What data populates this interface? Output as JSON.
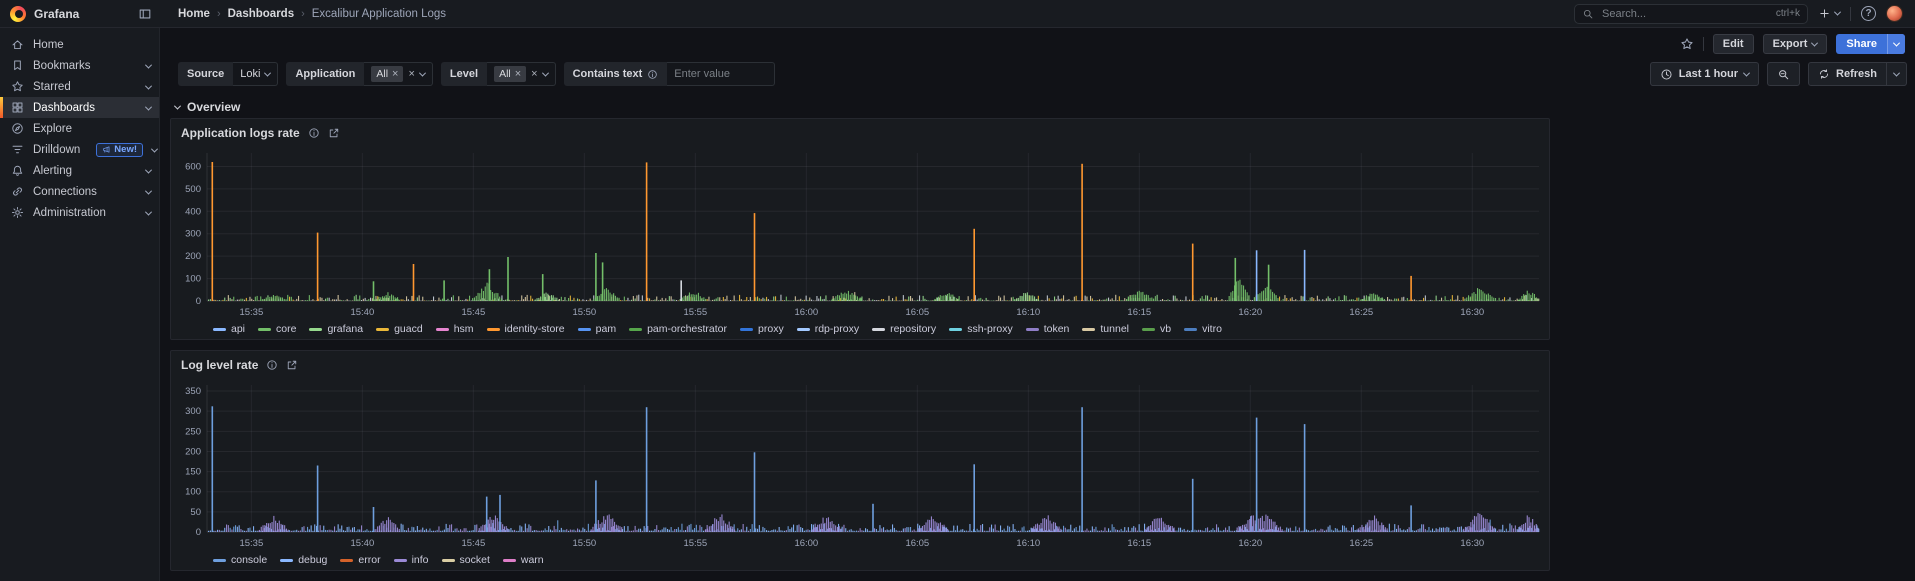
{
  "topbar": {
    "brand": "Grafana",
    "breadcrumb": [
      "Home",
      "Dashboards",
      "Excalibur Application Logs"
    ],
    "search_placeholder": "Search...",
    "search_shortcut": "ctrl+k"
  },
  "toolbar": {
    "edit_label": "Edit",
    "export_label": "Export",
    "share_label": "Share",
    "share_color": "#3D71D9"
  },
  "sidebar": {
    "items": [
      {
        "label": "Home",
        "icon": "home",
        "expandable": false,
        "active": false
      },
      {
        "label": "Bookmarks",
        "icon": "bookmark",
        "expandable": true,
        "active": false
      },
      {
        "label": "Starred",
        "icon": "star",
        "expandable": true,
        "active": false
      },
      {
        "label": "Dashboards",
        "icon": "apps",
        "expandable": true,
        "active": true
      },
      {
        "label": "Explore",
        "icon": "compass",
        "expandable": false,
        "active": false
      },
      {
        "label": "Drilldown",
        "icon": "drilldown",
        "expandable": true,
        "active": false,
        "badge": "New!"
      },
      {
        "label": "Alerting",
        "icon": "bell",
        "expandable": true,
        "active": false
      },
      {
        "label": "Connections",
        "icon": "plug",
        "expandable": true,
        "active": false
      },
      {
        "label": "Administration",
        "icon": "cog",
        "expandable": true,
        "active": false
      }
    ]
  },
  "filters": {
    "source": {
      "label": "Source",
      "value": "Loki"
    },
    "application": {
      "label": "Application",
      "chip": "All"
    },
    "level": {
      "label": "Level",
      "chip": "All"
    },
    "contains": {
      "label": "Contains text",
      "placeholder": "Enter value"
    }
  },
  "timebar": {
    "range_label": "Last 1 hour",
    "refresh_label": "Refresh"
  },
  "section": {
    "title": "Overview"
  },
  "icons": {
    "close": "×",
    "breadcrumb_separator": "›"
  },
  "chart_data": [
    {
      "type": "bar",
      "title": "Application logs rate",
      "ylim": [
        0,
        660
      ],
      "yticks": [
        0,
        100,
        200,
        300,
        400,
        500,
        600
      ],
      "x_ticks": [
        "15:35",
        "15:40",
        "15:45",
        "15:50",
        "15:55",
        "16:00",
        "16:05",
        "16:10",
        "16:15",
        "16:20",
        "16:25",
        "16:30"
      ],
      "x_tick_start": 0.0333,
      "x_tick_step": 0.08333,
      "grid": true,
      "legend_position": "bottom",
      "legend": [
        {
          "name": "api",
          "color": "#8AB8FF"
        },
        {
          "name": "core",
          "color": "#73BF69"
        },
        {
          "name": "grafana",
          "color": "#96D98D"
        },
        {
          "name": "guacd",
          "color": "#EAB839"
        },
        {
          "name": "hsm",
          "color": "#E685D0"
        },
        {
          "name": "identity-store",
          "color": "#FF9830"
        },
        {
          "name": "pam",
          "color": "#5794F2"
        },
        {
          "name": "pam-orchestrator",
          "color": "#56A64B"
        },
        {
          "name": "proxy",
          "color": "#3274D9"
        },
        {
          "name": "rdp-proxy",
          "color": "#A3C9FF"
        },
        {
          "name": "repository",
          "color": "#D4D7DE"
        },
        {
          "name": "ssh-proxy",
          "color": "#6ED0E0"
        },
        {
          "name": "token",
          "color": "#8F7EC7"
        },
        {
          "name": "tunnel",
          "color": "#D8C9A3"
        },
        {
          "name": "vb",
          "color": "#5A9E4C"
        },
        {
          "name": "vitro",
          "color": "#4D7EBF"
        }
      ],
      "spikes": [
        {
          "t": 0.004,
          "v": 620,
          "series": "identity-store"
        },
        {
          "t": 0.083,
          "v": 305,
          "series": "identity-store"
        },
        {
          "t": 0.125,
          "v": 88,
          "series": "core"
        },
        {
          "t": 0.155,
          "v": 165,
          "series": "identity-store"
        },
        {
          "t": 0.178,
          "v": 92,
          "series": "core"
        },
        {
          "t": 0.212,
          "v": 142,
          "series": "core"
        },
        {
          "t": 0.226,
          "v": 196,
          "series": "core"
        },
        {
          "t": 0.252,
          "v": 120,
          "series": "core"
        },
        {
          "t": 0.292,
          "v": 214,
          "series": "core"
        },
        {
          "t": 0.297,
          "v": 172,
          "series": "core"
        },
        {
          "t": 0.33,
          "v": 618,
          "series": "identity-store"
        },
        {
          "t": 0.356,
          "v": 92,
          "series": "repository"
        },
        {
          "t": 0.411,
          "v": 392,
          "series": "identity-store"
        },
        {
          "t": 0.576,
          "v": 322,
          "series": "identity-store"
        },
        {
          "t": 0.657,
          "v": 612,
          "series": "identity-store"
        },
        {
          "t": 0.74,
          "v": 256,
          "series": "identity-store"
        },
        {
          "t": 0.772,
          "v": 192,
          "series": "core"
        },
        {
          "t": 0.788,
          "v": 226,
          "series": "api"
        },
        {
          "t": 0.797,
          "v": 162,
          "series": "core"
        },
        {
          "t": 0.824,
          "v": 228,
          "series": "api"
        },
        {
          "t": 0.904,
          "v": 112,
          "series": "identity-store"
        }
      ],
      "mounds": [
        {
          "t": 0.05,
          "h": 38,
          "w": 0.02,
          "series": "core"
        },
        {
          "t": 0.135,
          "h": 42,
          "w": 0.018,
          "series": "core"
        },
        {
          "t": 0.21,
          "h": 88,
          "w": 0.022,
          "series": "core"
        },
        {
          "t": 0.255,
          "h": 46,
          "w": 0.018,
          "series": "grafana"
        },
        {
          "t": 0.3,
          "h": 70,
          "w": 0.02,
          "series": "core"
        },
        {
          "t": 0.365,
          "h": 52,
          "w": 0.02,
          "series": "core"
        },
        {
          "t": 0.48,
          "h": 56,
          "w": 0.022,
          "series": "core"
        },
        {
          "t": 0.555,
          "h": 50,
          "w": 0.018,
          "series": "core"
        },
        {
          "t": 0.615,
          "h": 46,
          "w": 0.018,
          "series": "grafana"
        },
        {
          "t": 0.7,
          "h": 56,
          "w": 0.02,
          "series": "core"
        },
        {
          "t": 0.775,
          "h": 118,
          "w": 0.016,
          "series": "core"
        },
        {
          "t": 0.795,
          "h": 96,
          "w": 0.018,
          "series": "core"
        },
        {
          "t": 0.875,
          "h": 46,
          "w": 0.018,
          "series": "core"
        },
        {
          "t": 0.955,
          "h": 66,
          "w": 0.022,
          "series": "core"
        },
        {
          "t": 0.992,
          "h": 56,
          "w": 0.016,
          "series": "core"
        }
      ],
      "noise": {
        "seed": 11,
        "max": 26,
        "base": 2,
        "colors": [
          "#D8C9A3",
          "#C9CFD8",
          "#73BF69",
          "#96D98D",
          "#EAB839",
          "#D8C9A3"
        ]
      }
    },
    {
      "type": "bar",
      "title": "Log level rate",
      "ylim": [
        0,
        365
      ],
      "yticks": [
        0,
        50,
        100,
        150,
        200,
        250,
        300,
        350
      ],
      "x_ticks": [
        "15:35",
        "15:40",
        "15:45",
        "15:50",
        "15:55",
        "16:00",
        "16:05",
        "16:10",
        "16:15",
        "16:20",
        "16:25",
        "16:30"
      ],
      "x_tick_start": 0.0333,
      "x_tick_step": 0.08333,
      "grid": true,
      "legend_position": "bottom",
      "legend": [
        {
          "name": "console",
          "color": "#6E9FDE"
        },
        {
          "name": "debug",
          "color": "#8AB8FF"
        },
        {
          "name": "error",
          "color": "#D4622A"
        },
        {
          "name": "info",
          "color": "#9B8AD6"
        },
        {
          "name": "socket",
          "color": "#D9CDA3"
        },
        {
          "name": "warn",
          "color": "#DE7EC8"
        }
      ],
      "spikes": [
        {
          "t": 0.004,
          "v": 312,
          "series": "console"
        },
        {
          "t": 0.083,
          "v": 165,
          "series": "console"
        },
        {
          "t": 0.125,
          "v": 62,
          "series": "console"
        },
        {
          "t": 0.21,
          "v": 88,
          "series": "console"
        },
        {
          "t": 0.22,
          "v": 92,
          "series": "console"
        },
        {
          "t": 0.292,
          "v": 128,
          "series": "console"
        },
        {
          "t": 0.33,
          "v": 310,
          "series": "console"
        },
        {
          "t": 0.411,
          "v": 198,
          "series": "console"
        },
        {
          "t": 0.5,
          "v": 70,
          "series": "console"
        },
        {
          "t": 0.576,
          "v": 168,
          "series": "console"
        },
        {
          "t": 0.657,
          "v": 310,
          "series": "console"
        },
        {
          "t": 0.74,
          "v": 132,
          "series": "console"
        },
        {
          "t": 0.788,
          "v": 284,
          "series": "console"
        },
        {
          "t": 0.824,
          "v": 268,
          "series": "console"
        },
        {
          "t": 0.904,
          "v": 66,
          "series": "console"
        }
      ],
      "mounds": [
        {
          "t": 0.05,
          "h": 46,
          "w": 0.022,
          "series": "info"
        },
        {
          "t": 0.135,
          "h": 40,
          "w": 0.02,
          "series": "info"
        },
        {
          "t": 0.215,
          "h": 50,
          "w": 0.022,
          "series": "info"
        },
        {
          "t": 0.3,
          "h": 56,
          "w": 0.024,
          "series": "info"
        },
        {
          "t": 0.385,
          "h": 50,
          "w": 0.022,
          "series": "info"
        },
        {
          "t": 0.465,
          "h": 46,
          "w": 0.022,
          "series": "info"
        },
        {
          "t": 0.545,
          "h": 50,
          "w": 0.022,
          "series": "info"
        },
        {
          "t": 0.63,
          "h": 48,
          "w": 0.022,
          "series": "info"
        },
        {
          "t": 0.715,
          "h": 50,
          "w": 0.022,
          "series": "info"
        },
        {
          "t": 0.79,
          "h": 58,
          "w": 0.034,
          "series": "info"
        },
        {
          "t": 0.875,
          "h": 46,
          "w": 0.022,
          "series": "info"
        },
        {
          "t": 0.955,
          "h": 54,
          "w": 0.024,
          "series": "info"
        },
        {
          "t": 0.992,
          "h": 48,
          "w": 0.016,
          "series": "info"
        }
      ],
      "noise": {
        "seed": 23,
        "max": 18,
        "base": 3,
        "colors": [
          "#8AB8FF",
          "#6E9FDE",
          "#8AB8FF",
          "#9B8AD6"
        ]
      }
    }
  ]
}
